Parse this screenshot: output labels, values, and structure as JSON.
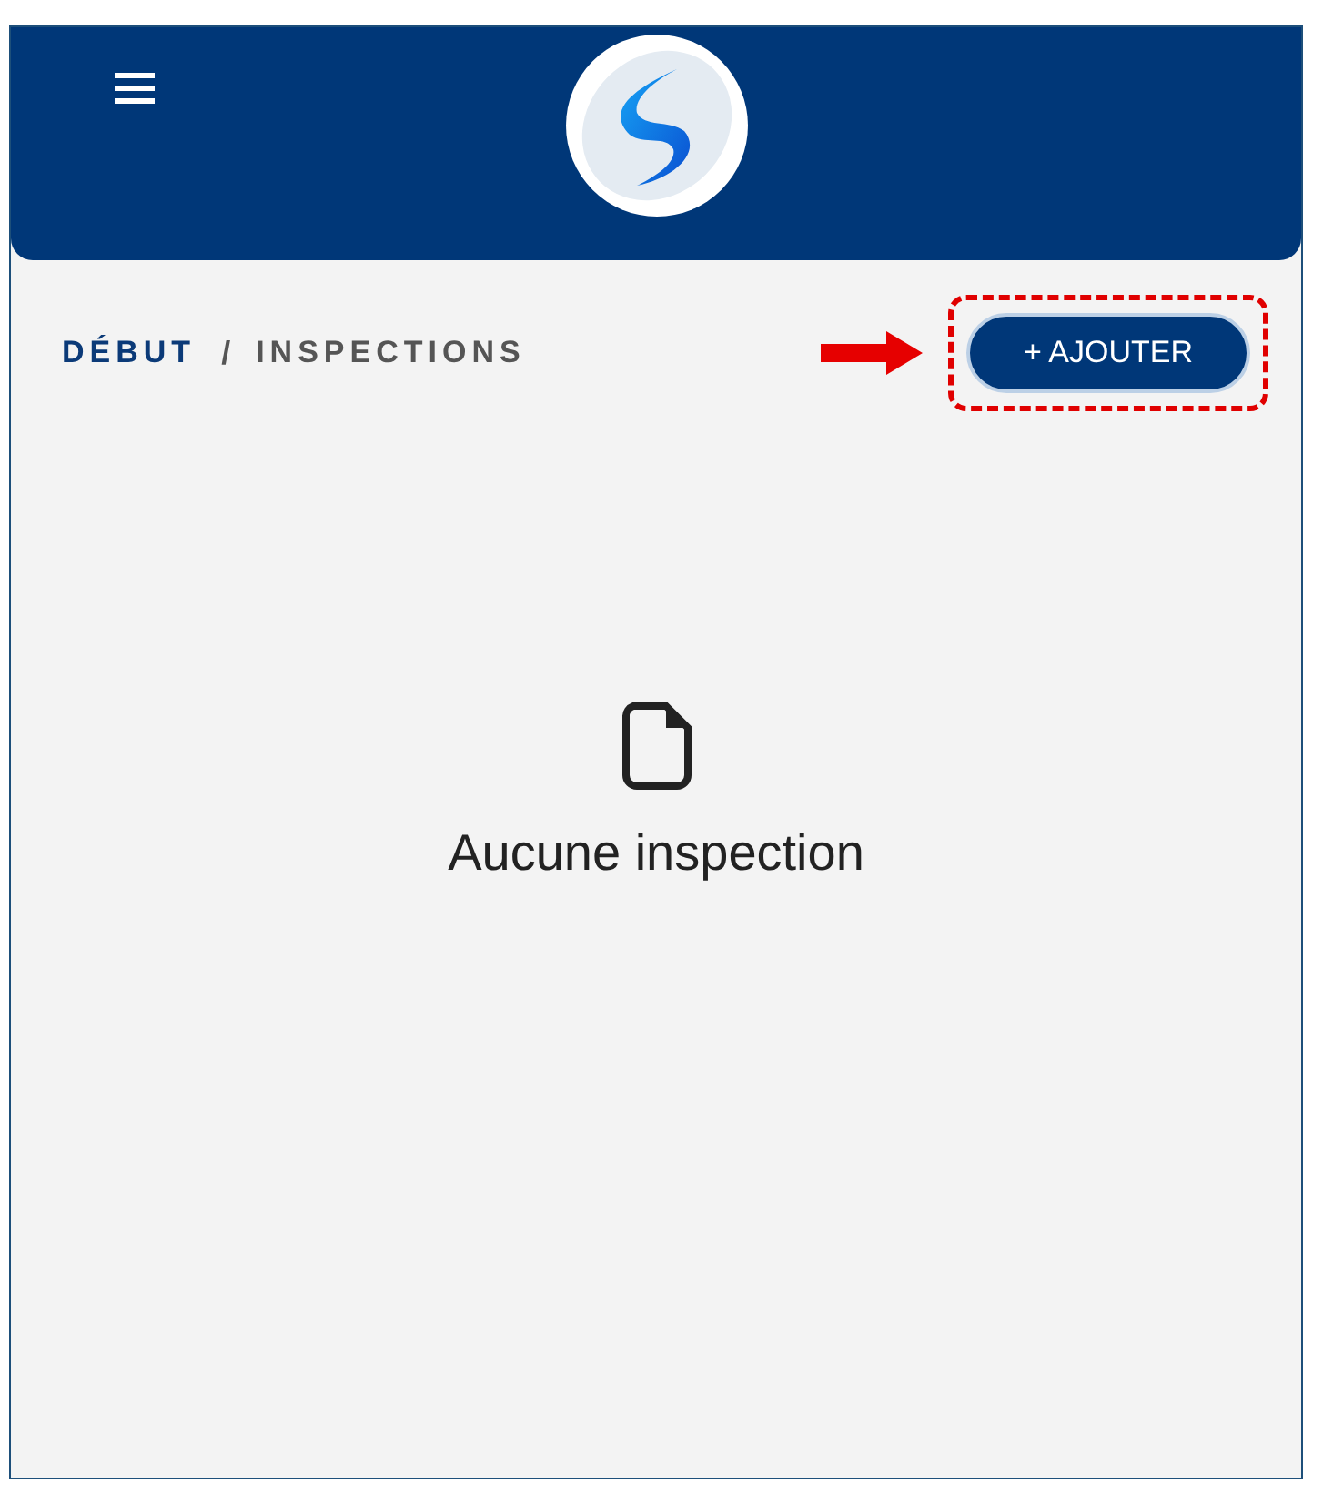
{
  "breadcrumb": [
    {
      "label": "DÉBUT",
      "selected": false
    },
    {
      "label": "/",
      "kind": "separator"
    },
    {
      "label": "INSPECTIONS",
      "selected": true
    }
  ],
  "add_button": {
    "label": "+ AJOUTER",
    "highlighted": true
  },
  "empty_state": {
    "message": "Aucune inspection"
  }
}
